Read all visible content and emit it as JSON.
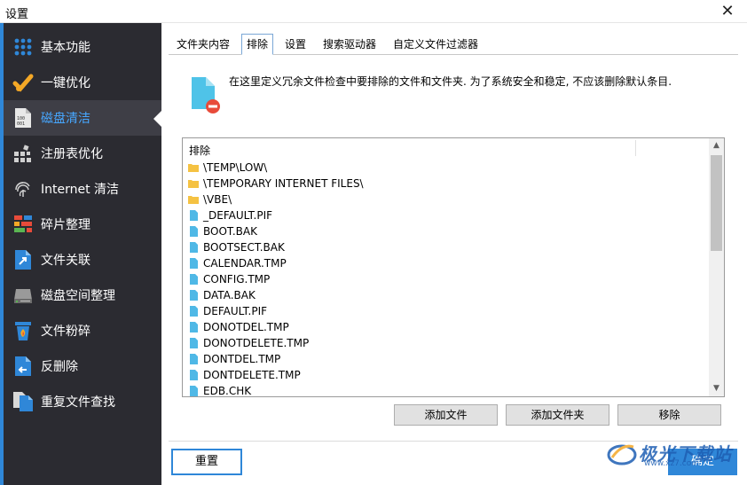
{
  "window": {
    "title": "设置",
    "close": "✕"
  },
  "sidebar": {
    "items": [
      {
        "label": "基本功能",
        "icon": "grid-dots-icon"
      },
      {
        "label": "一键优化",
        "icon": "check-icon"
      },
      {
        "label": "磁盘清洁",
        "icon": "disk-file-icon",
        "active": true
      },
      {
        "label": "注册表优化",
        "icon": "registry-icon"
      },
      {
        "label": "Internet 清洁",
        "icon": "fingerprint-icon"
      },
      {
        "label": "碎片整理",
        "icon": "defrag-icon"
      },
      {
        "label": "文件关联",
        "icon": "file-link-icon"
      },
      {
        "label": "磁盘空间整理",
        "icon": "hard-drive-icon"
      },
      {
        "label": "文件粉碎",
        "icon": "shredder-icon"
      },
      {
        "label": "反删除",
        "icon": "undelete-icon"
      },
      {
        "label": "重复文件查找",
        "icon": "duplicate-files-icon"
      }
    ]
  },
  "tabs": [
    {
      "label": "文件夹内容"
    },
    {
      "label": "排除",
      "active": true
    },
    {
      "label": "设置"
    },
    {
      "label": "搜索驱动器"
    },
    {
      "label": "自定义文件过滤器"
    }
  ],
  "info": {
    "text": "在这里定义冗余文件检查中要排除的文件和文件夹. 为了系统安全和稳定, 不应该删除默认条目."
  },
  "list": {
    "header": "排除",
    "rows": [
      {
        "name": "\\TEMP\\LOW\\",
        "type": "folder"
      },
      {
        "name": "\\TEMPORARY INTERNET FILES\\",
        "type": "folder"
      },
      {
        "name": "\\VBE\\",
        "type": "folder"
      },
      {
        "name": "_DEFAULT.PIF",
        "type": "file"
      },
      {
        "name": "BOOT.BAK",
        "type": "file"
      },
      {
        "name": "BOOTSECT.BAK",
        "type": "file"
      },
      {
        "name": "CALENDAR.TMP",
        "type": "file"
      },
      {
        "name": "CONFIG.TMP",
        "type": "file"
      },
      {
        "name": "DATA.BAK",
        "type": "file"
      },
      {
        "name": "DEFAULT.PIF",
        "type": "file"
      },
      {
        "name": "DONOTDEL.TMP",
        "type": "file"
      },
      {
        "name": "DONOTDELETE.TMP",
        "type": "file"
      },
      {
        "name": "DONTDEL.TMP",
        "type": "file"
      },
      {
        "name": "DONTDELETE.TMP",
        "type": "file"
      },
      {
        "name": "EDB.CHK",
        "type": "file"
      }
    ]
  },
  "buttons": {
    "add_file": "添加文件",
    "add_folder": "添加文件夹",
    "remove": "移除",
    "reset": "重置",
    "ok": "确定"
  },
  "watermark": {
    "text": "极光下载站",
    "url": "www.xz7.com"
  },
  "colors": {
    "accent": "#2f87d8",
    "sidebar_bg": "#2b2b31",
    "active_text": "#47a7ff",
    "folder": "#f5c242",
    "file": "#4fb8e6"
  }
}
